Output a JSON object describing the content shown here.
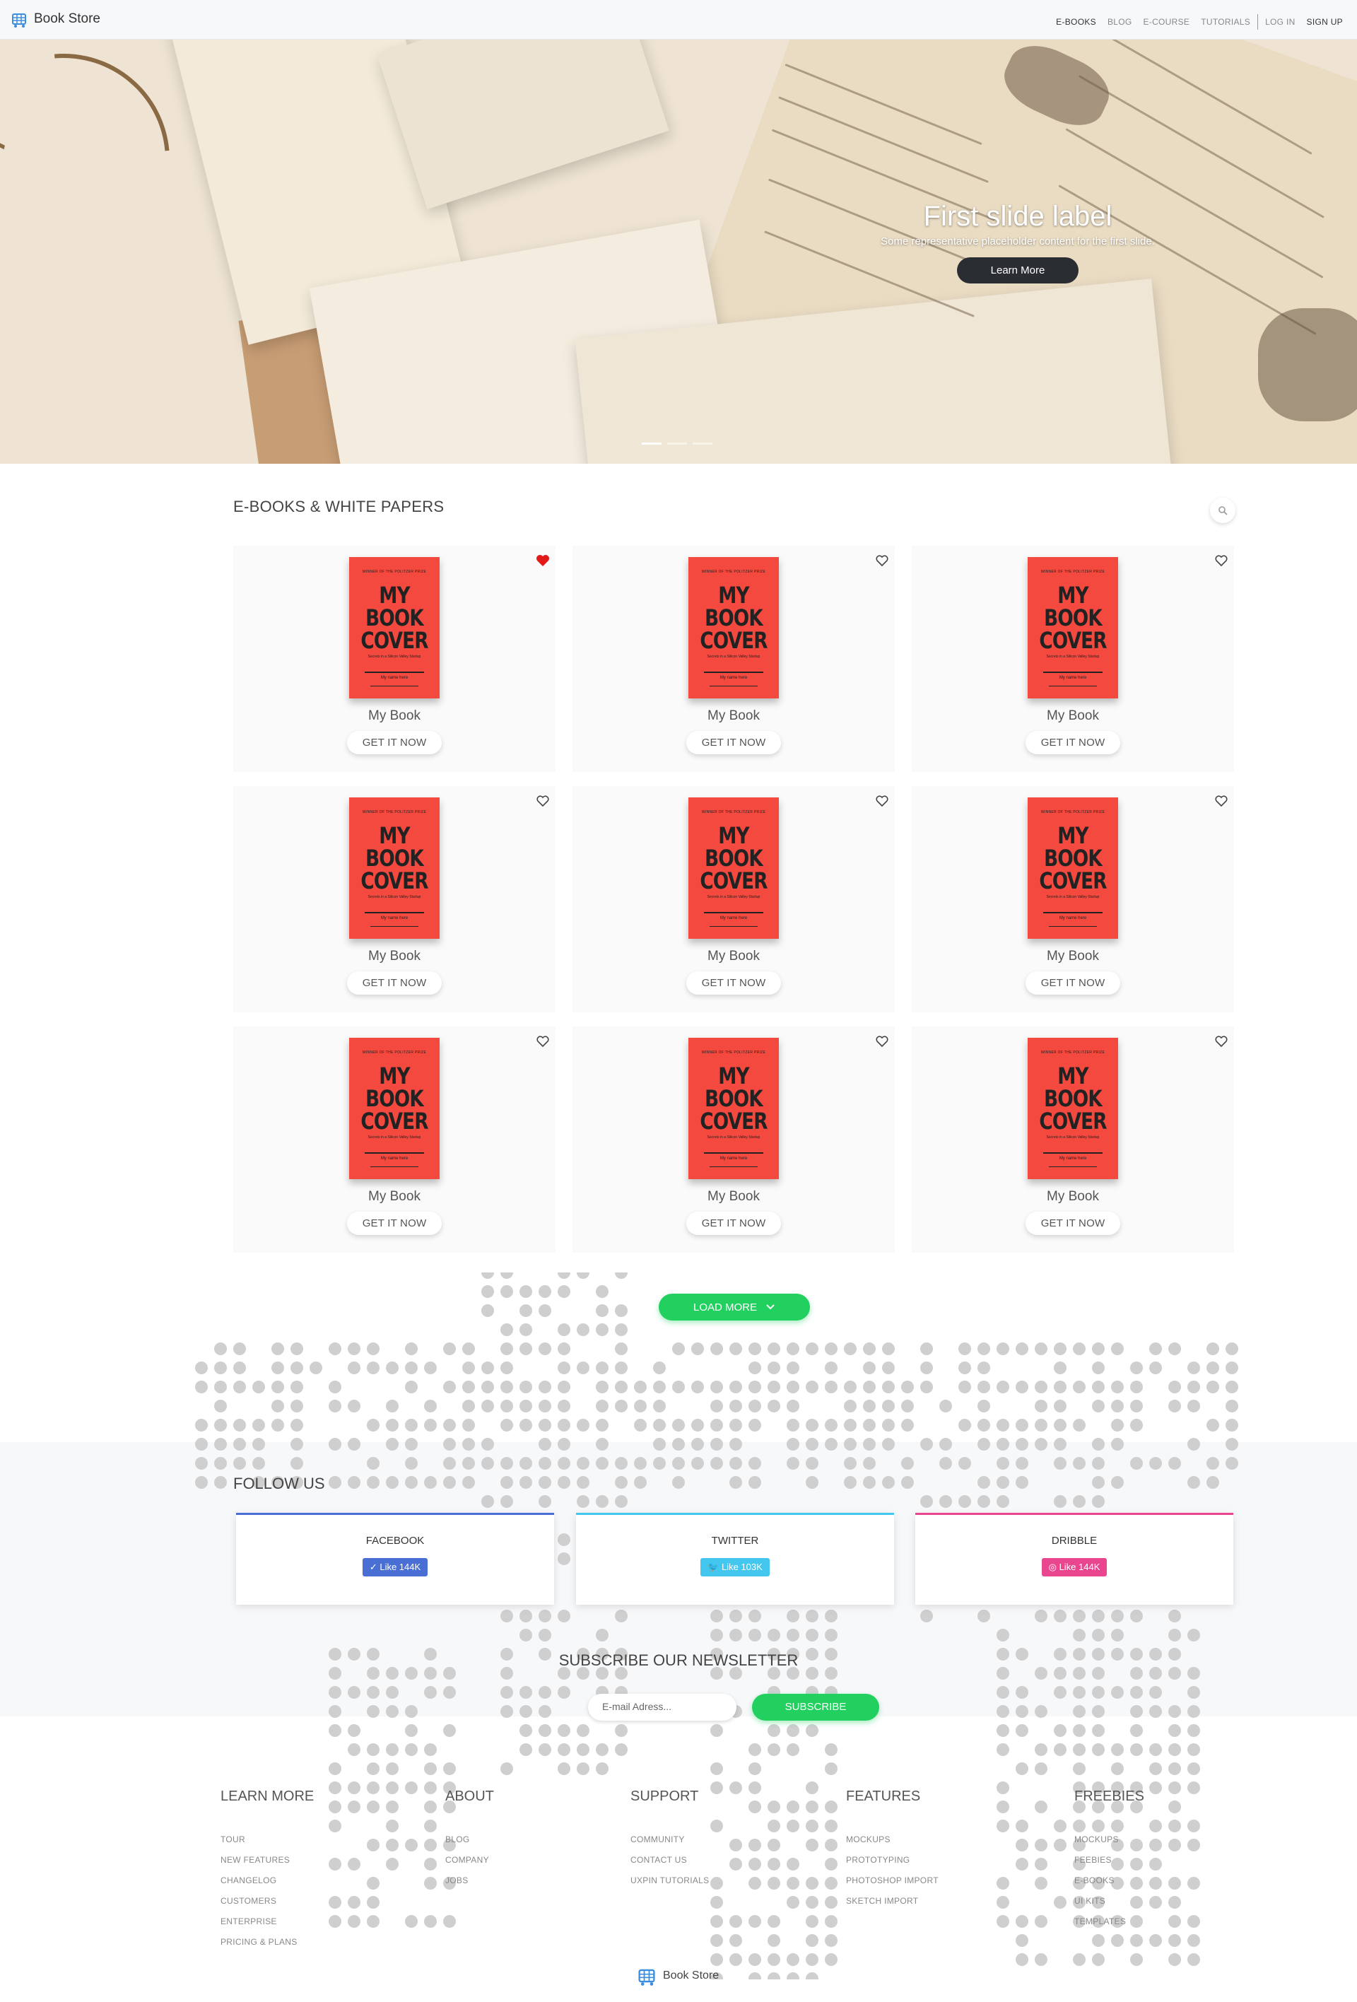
{
  "nav": {
    "brand": "Book Store",
    "links": [
      "E-BOOKS",
      "BLOG",
      "E-COURSE",
      "TUTORIALS"
    ],
    "login": "LOG IN",
    "signup": "SIGN UP"
  },
  "hero": {
    "title": "First slide label",
    "subtitle": "Some representative placeholder content for the first slide.",
    "button": "Learn More",
    "slides": 3,
    "active_slide": 1
  },
  "books": {
    "section_title": "E-BOOKS & WHITE PAPERS",
    "items": [
      {
        "title": "My Book",
        "button": "GET IT NOW",
        "favorited": true
      },
      {
        "title": "My Book",
        "button": "GET IT NOW",
        "favorited": false
      },
      {
        "title": "My Book",
        "button": "GET IT NOW",
        "favorited": false
      },
      {
        "title": "My Book",
        "button": "GET IT NOW",
        "favorited": false
      },
      {
        "title": "My Book",
        "button": "GET IT NOW",
        "favorited": false
      },
      {
        "title": "My Book",
        "button": "GET IT NOW",
        "favorited": false
      },
      {
        "title": "My Book",
        "button": "GET IT NOW",
        "favorited": false
      },
      {
        "title": "My Book",
        "button": "GET IT NOW",
        "favorited": false
      },
      {
        "title": "My Book",
        "button": "GET IT NOW",
        "favorited": false
      }
    ],
    "cover": {
      "top_text": "WINNER OF THE POLITZER PRIZE",
      "title_line1": "MY",
      "title_line2": "BOOK",
      "title_line3": "COVER",
      "subtitle": "Secrets in a Silicon Valley Startup",
      "author": "My name here",
      "bottom_text": "BOOK SUBTITLE"
    },
    "load_more": "LOAD MORE"
  },
  "follow": {
    "title": "FOLLOW US",
    "networks": [
      {
        "name": "FACEBOOK",
        "like": "Like 144K",
        "color": "#4a6fd4"
      },
      {
        "name": "TWITTER",
        "like": "Like 103K",
        "color": "#43c7ee"
      },
      {
        "name": "DRIBBLE",
        "like": "Like 144K",
        "color": "#e9468f"
      }
    ]
  },
  "newsletter": {
    "title": "SUBSCRIBE OUR NEWSLETTER",
    "placeholder": "E-mail Adress...",
    "button": "SUBSCRIBE"
  },
  "footer": {
    "columns": [
      {
        "title": "LEARN MORE",
        "links": [
          "TOUR",
          "NEW FEATURES",
          "CHANGELOG",
          "CUSTOMERS",
          "ENTERPRISE",
          "PRICING & PLANS"
        ]
      },
      {
        "title": "ABOUT",
        "links": [
          "BLOG",
          "COMPANY",
          "JOBS"
        ]
      },
      {
        "title": "SUPPORT",
        "links": [
          "COMMUNITY",
          "CONTACT US",
          "UXPIN TUTORIALS"
        ]
      },
      {
        "title": "FEATURES",
        "links": [
          "MOCKUPS",
          "PROTOTYPING",
          "PHOTOSHOP IMPORT",
          "SKETCH IMPORT"
        ]
      },
      {
        "title": "FREEBIES",
        "links": [
          "MOCKUPS",
          "FEEBIES",
          "E-BOOKS",
          "UI KITS",
          "TEMPLATES"
        ]
      }
    ],
    "brand": "Book Store"
  },
  "colors": {
    "accent_green": "#21d05e",
    "dark_button": "#2a2e33",
    "cover_red": "#f4493e",
    "heart_red": "#e21a1a",
    "brand_icon": "#3b8de0"
  }
}
